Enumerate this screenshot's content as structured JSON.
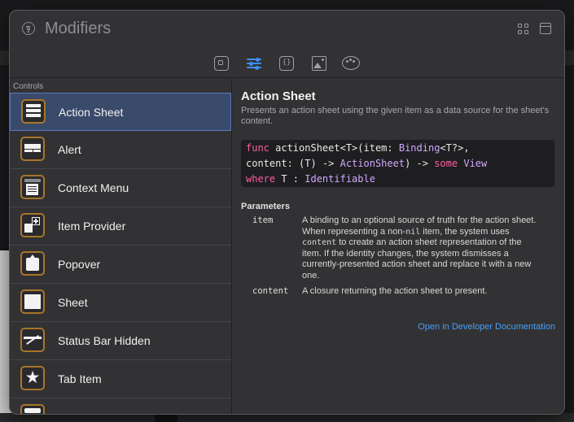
{
  "window": {
    "title": "Modifiers"
  },
  "toolbar": {
    "tabs": [
      {
        "icon": "square-icon"
      },
      {
        "icon": "sliders-icon",
        "selected": true
      },
      {
        "icon": "braces-icon",
        "glyph": "{}"
      },
      {
        "icon": "image-icon"
      },
      {
        "icon": "palette-icon"
      }
    ]
  },
  "sidebar": {
    "section": "Controls",
    "items": [
      {
        "label": "Action Sheet",
        "icon": "action-sheet-icon",
        "selected": true
      },
      {
        "label": "Alert",
        "icon": "alert-icon"
      },
      {
        "label": "Context Menu",
        "icon": "context-menu-icon"
      },
      {
        "label": "Item Provider",
        "icon": "item-provider-icon"
      },
      {
        "label": "Popover",
        "icon": "popover-icon"
      },
      {
        "label": "Sheet",
        "icon": "sheet-icon"
      },
      {
        "label": "Status Bar Hidden",
        "icon": "status-bar-hidden-icon"
      },
      {
        "label": "Tab Item",
        "icon": "tab-item-icon"
      }
    ]
  },
  "detail": {
    "title": "Action Sheet",
    "description": "Presents an action sheet using the given item as a data source for the sheet’s content.",
    "signature": {
      "line1": [
        "func",
        " actionSheet<T>(item: ",
        "Binding",
        "<T?>,"
      ],
      "line2": [
        "content: (T) -> ",
        "ActionSheet",
        ") -> ",
        "some",
        " ",
        "View"
      ],
      "line3": [
        "where",
        " T : ",
        "Identifiable"
      ]
    },
    "parameters_heading": "Parameters",
    "parameters": [
      {
        "name": "item",
        "desc_parts": [
          "A binding to an optional source of truth for the action sheet. When representing a non-",
          "nil",
          " item, the system uses ",
          "content",
          " to create an action sheet representation of the item. If the identity changes, the system dismisses a currently-presented action sheet and replace it with a new one."
        ]
      },
      {
        "name": "content",
        "description": "A closure returning the action sheet to present."
      }
    ],
    "link": "Open in Developer Documentation"
  },
  "colors": {
    "accent": "#3d8ff5",
    "keyword": "#fc5fa3",
    "type": "#d0a8ff",
    "icon_border": "#a8752a",
    "link": "#4a9ff5"
  }
}
